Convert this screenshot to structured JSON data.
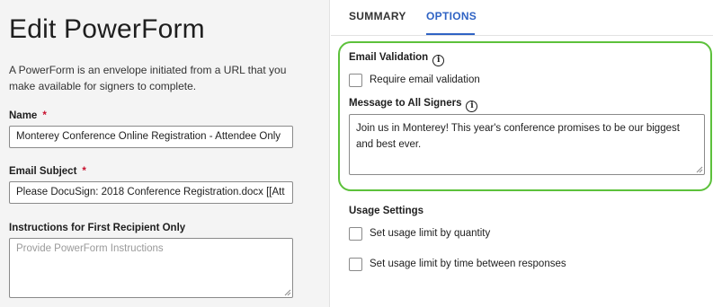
{
  "page": {
    "title": "Edit PowerForm",
    "description": "A PowerForm is an envelope initiated from a URL that you make available for signers to complete."
  },
  "form": {
    "name_label": "Name",
    "name_required_mark": "*",
    "name_value": "Monterey Conference Online Registration - Attendee Only",
    "email_subject_label": "Email Subject",
    "email_subject_required_mark": "*",
    "email_subject_value": "Please DocuSign: 2018 Conference Registration.docx [[Att",
    "instructions_label": "Instructions for First Recipient Only",
    "instructions_placeholder": "Provide PowerForm Instructions"
  },
  "tabs": [
    {
      "label": "SUMMARY",
      "active": false
    },
    {
      "label": "OPTIONS",
      "active": true
    }
  ],
  "options": {
    "email_validation_label": "Email Validation",
    "info_glyph": "i",
    "require_email_validation_label": "Require email validation",
    "require_email_validation_checked": false,
    "message_label": "Message to All Signers",
    "message_value": "Join us in Monterey! This year's conference promises to be our biggest and best ever.",
    "usage_settings_label": "Usage Settings",
    "usage_limit_quantity_label": "Set usage limit by quantity",
    "usage_limit_quantity_checked": false,
    "usage_limit_time_label": "Set usage limit by time between responses",
    "usage_limit_time_checked": false
  },
  "colors": {
    "accent": "#2f63c4",
    "required": "#c8102e",
    "highlight": "#5cc13b",
    "left_panel_bg": "#f4f4f4"
  },
  "icons": {
    "info": "info-circle-icon",
    "resize": "resize-handle-icon"
  }
}
